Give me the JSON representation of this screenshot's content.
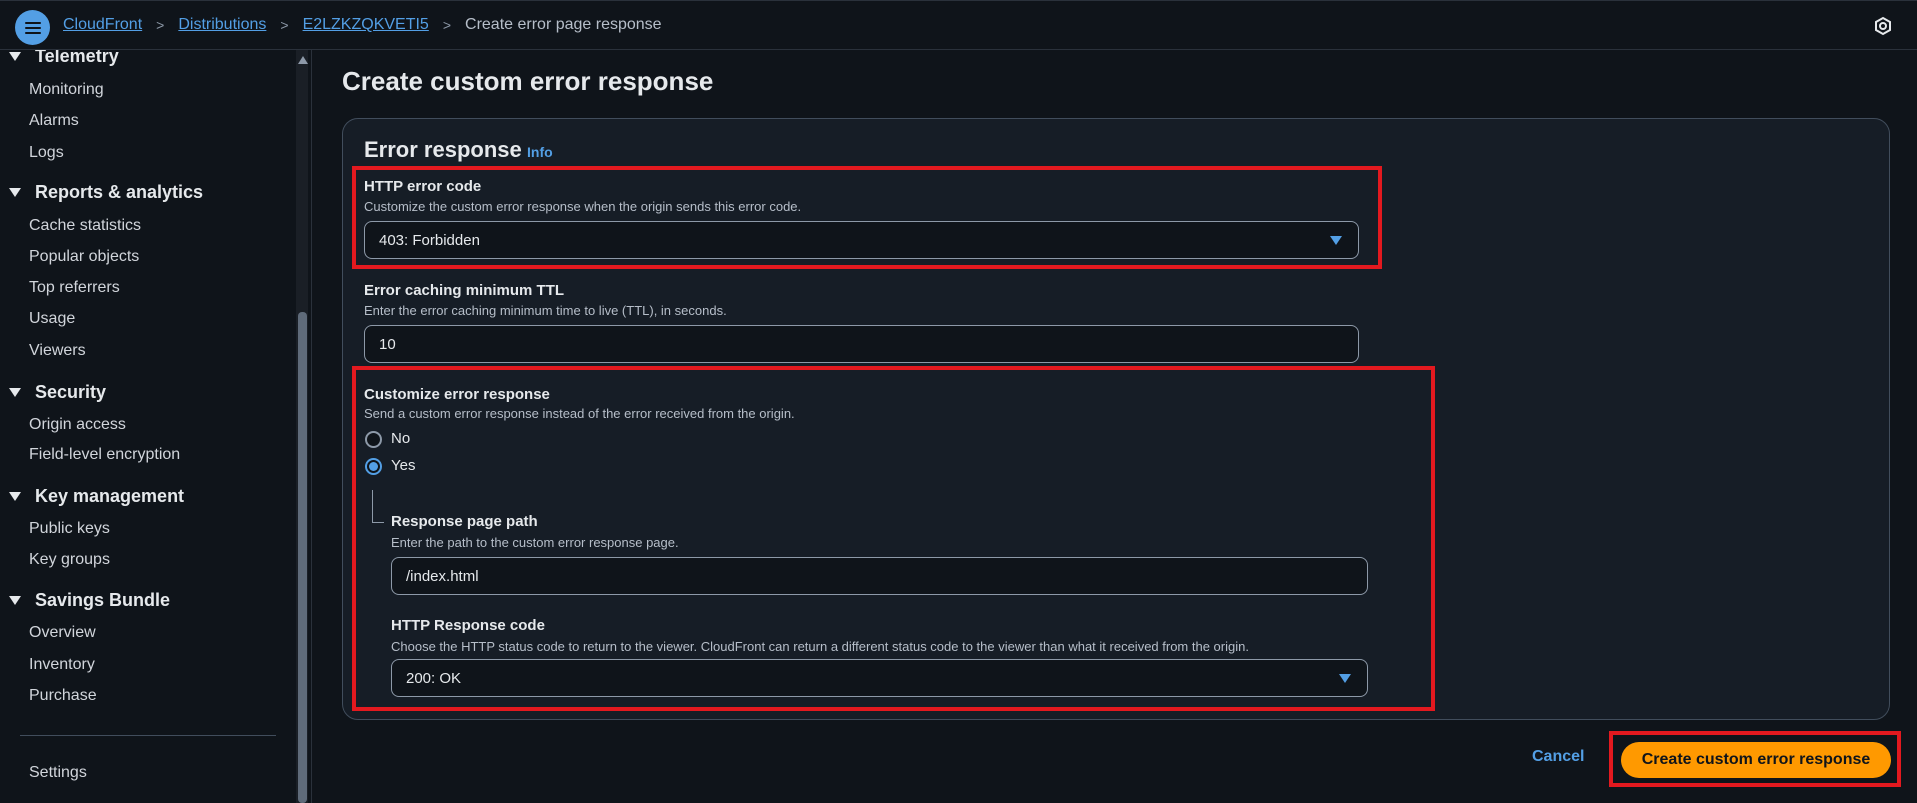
{
  "topbar": {
    "breadcrumbs": [
      {
        "label": "CloudFront"
      },
      {
        "label": "Distributions"
      },
      {
        "label": "E2LZKZQKVETI5"
      },
      {
        "label": "Create error page response"
      }
    ]
  },
  "sidebar": {
    "sections": [
      {
        "title": "Telemetry",
        "items": [
          "Monitoring",
          "Alarms",
          "Logs"
        ]
      },
      {
        "title": "Reports & analytics",
        "items": [
          "Cache statistics",
          "Popular objects",
          "Top referrers",
          "Usage",
          "Viewers"
        ]
      },
      {
        "title": "Security",
        "items": [
          "Origin access",
          "Field-level encryption"
        ]
      },
      {
        "title": "Key management",
        "items": [
          "Public keys",
          "Key groups"
        ]
      },
      {
        "title": "Savings Bundle",
        "items": [
          "Overview",
          "Inventory",
          "Purchase"
        ]
      }
    ],
    "settings_label": "Settings"
  },
  "main": {
    "page_title": "Create custom error response",
    "panel": {
      "title": "Error response",
      "info_label": "Info",
      "http_error_code": {
        "label": "HTTP error code",
        "description": "Customize the custom error response when the origin sends this error code.",
        "value": "403: Forbidden"
      },
      "ttl": {
        "label": "Error caching minimum TTL",
        "description": "Enter the error caching minimum time to live (TTL), in seconds.",
        "value": "10"
      },
      "customize": {
        "label": "Customize error response",
        "description": "Send a custom error response instead of the error received from the origin.",
        "options": [
          "No",
          "Yes"
        ],
        "selected": "Yes"
      },
      "response_page_path": {
        "label": "Response page path",
        "description": "Enter the path to the custom error response page.",
        "value": "/index.html"
      },
      "http_response_code": {
        "label": "HTTP Response code",
        "description": "Choose the HTTP status code to return to the viewer. CloudFront can return a different status code to the viewer than what it received from the origin.",
        "value": "200: OK"
      }
    },
    "cancel_label": "Cancel",
    "submit_label": "Create custom error response"
  },
  "colors": {
    "accent": "#539fe5",
    "primary_button": "#ff9900",
    "highlight": "#e3191f",
    "background": "#0f141a"
  }
}
